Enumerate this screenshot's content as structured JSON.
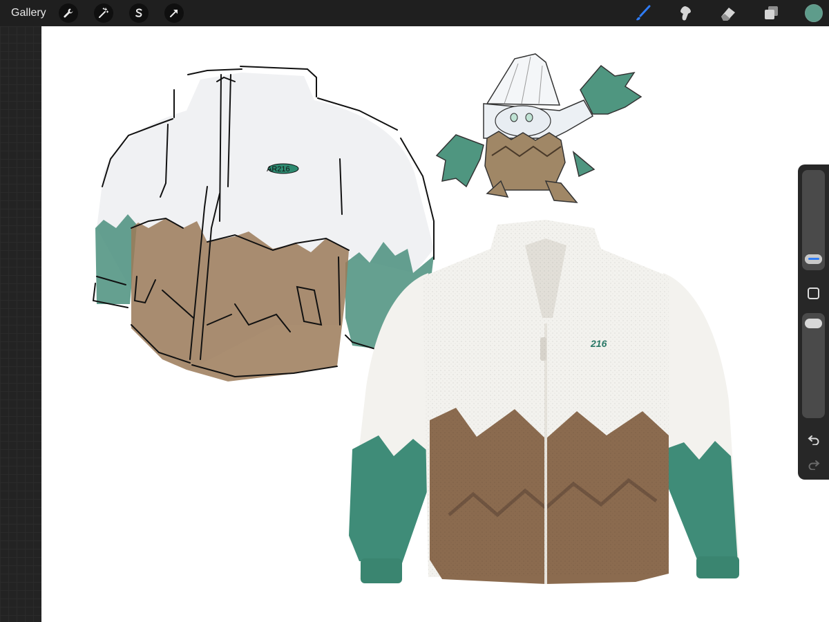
{
  "toolbar": {
    "gallery_label": "Gallery",
    "left_tools": [
      "wrench-icon",
      "magic-wand-icon",
      "selection-icon",
      "transform-arrow-icon"
    ],
    "right_tools": [
      "brush-icon",
      "smudge-icon",
      "eraser-icon",
      "layers-icon"
    ],
    "active_tool": "brush-icon",
    "accent_color": "#2f7cf6",
    "current_color": "#5e9c8b"
  },
  "canvas": {
    "sketch_chest_text": "AR216",
    "product_chest_text": "216",
    "colors": {
      "snow": "#f3f2ee",
      "brown": "#8b6b4f",
      "green": "#3f8c78"
    }
  },
  "sidebar": {
    "brush_size_level": 0.14,
    "opacity_level": 0.06,
    "undo": "undo-icon",
    "redo": "redo-icon"
  }
}
